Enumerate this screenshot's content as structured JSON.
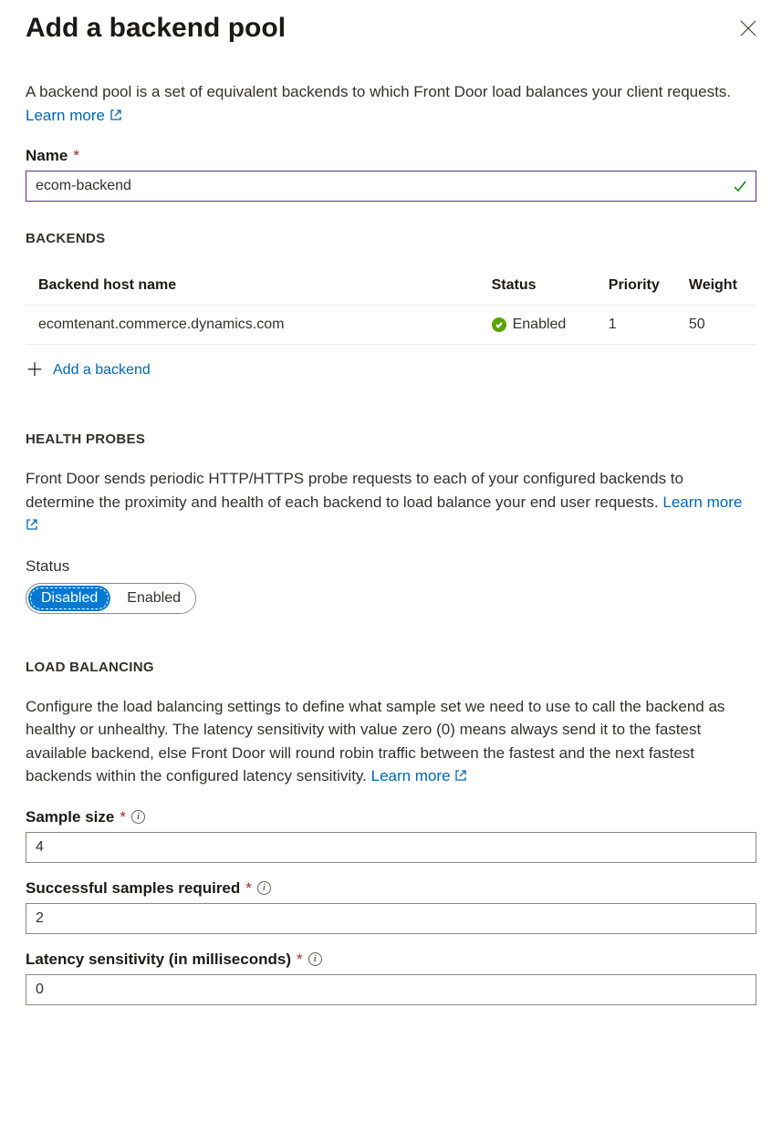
{
  "header": {
    "title": "Add a backend pool"
  },
  "intro": {
    "text": "A backend pool is a set of equivalent backends to which Front Door load balances your client requests. ",
    "learn_more": "Learn more"
  },
  "name_field": {
    "label": "Name",
    "value": "ecom-backend"
  },
  "backends": {
    "section_title": "BACKENDS",
    "columns": {
      "host": "Backend host name",
      "status": "Status",
      "priority": "Priority",
      "weight": "Weight"
    },
    "rows": [
      {
        "host": "ecomtenant.commerce.dynamics.com",
        "status": "Enabled",
        "priority": "1",
        "weight": "50"
      }
    ],
    "add_label": "Add a backend"
  },
  "health_probes": {
    "section_title": "HEALTH PROBES",
    "description": "Front Door sends periodic HTTP/HTTPS probe requests to each of your configured backends to determine the proximity and health of each backend to load balance your end user requests. ",
    "learn_more": "Learn more",
    "status_label": "Status",
    "disabled": "Disabled",
    "enabled": "Enabled"
  },
  "load_balancing": {
    "section_title": "LOAD BALANCING",
    "description": "Configure the load balancing settings to define what sample set we need to use to call the backend as healthy or unhealthy. The latency sensitivity with value zero (0) means always send it to the fastest available backend, else Front Door will round robin traffic between the fastest and the next fastest backends within the configured latency sensitivity. ",
    "learn_more": "Learn more",
    "sample_size": {
      "label": "Sample size",
      "value": "4"
    },
    "successful_samples": {
      "label": "Successful samples required",
      "value": "2"
    },
    "latency": {
      "label": "Latency sensitivity (in milliseconds)",
      "value": "0"
    }
  }
}
